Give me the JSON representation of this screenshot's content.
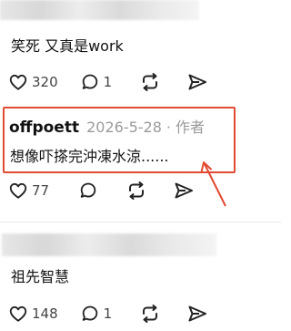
{
  "post_top": {
    "text": "笑死 又真是work",
    "likes": "320",
    "replies": "1"
  },
  "highlighted_comment": {
    "username": "offpoett",
    "date": "2026-5-28",
    "separator": "·",
    "author_tag": "作者",
    "text": "想像吓搽完沖凍水涼......",
    "likes": "77"
  },
  "post_bottom": {
    "text": "祖先智慧",
    "likes": "148",
    "replies": "1"
  },
  "colors": {
    "annotation": "#e24a33",
    "meta_gray": "#9a9a9a"
  },
  "icons": [
    "heart-icon",
    "comment-icon",
    "repost-icon",
    "share-icon"
  ]
}
